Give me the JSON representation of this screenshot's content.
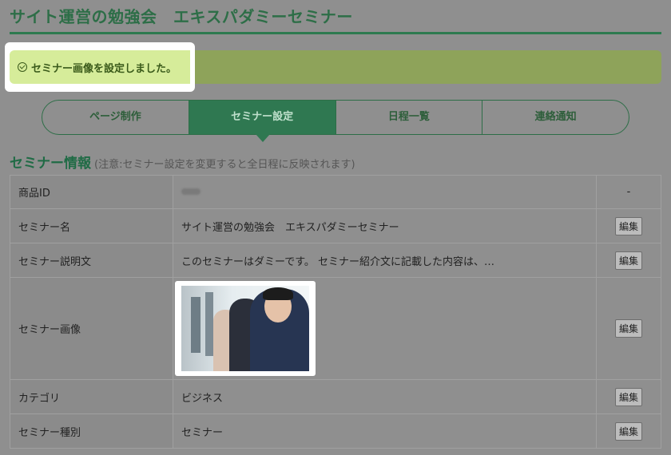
{
  "page": {
    "title": "サイト運営の勉強会　エキスパダミーセミナー"
  },
  "alert": {
    "message": "セミナー画像を設定しました。"
  },
  "tabs": [
    {
      "label": "ページ制作",
      "active": false
    },
    {
      "label": "セミナー設定",
      "active": true
    },
    {
      "label": "日程一覧",
      "active": false
    },
    {
      "label": "連絡通知",
      "active": false
    }
  ],
  "section": {
    "title": "セミナー情報",
    "note": "(注意:セミナー設定を変更すると全日程に反映されます)"
  },
  "table": {
    "edit_label": "編集",
    "rows": [
      {
        "label": "商品ID",
        "value": "",
        "action": "-"
      },
      {
        "label": "セミナー名",
        "value": "サイト運営の勉強会　エキスパダミーセミナー",
        "action": "編集"
      },
      {
        "label": "セミナー説明文",
        "value": "このセミナーはダミーです。 セミナー紹介文に記載した内容は、…",
        "action": "編集"
      },
      {
        "label": "セミナー画像",
        "value": "",
        "action": "編集"
      },
      {
        "label": "カテゴリ",
        "value": "ビジネス",
        "action": "編集"
      },
      {
        "label": "セミナー種別",
        "value": "セミナー",
        "action": "編集"
      }
    ]
  }
}
